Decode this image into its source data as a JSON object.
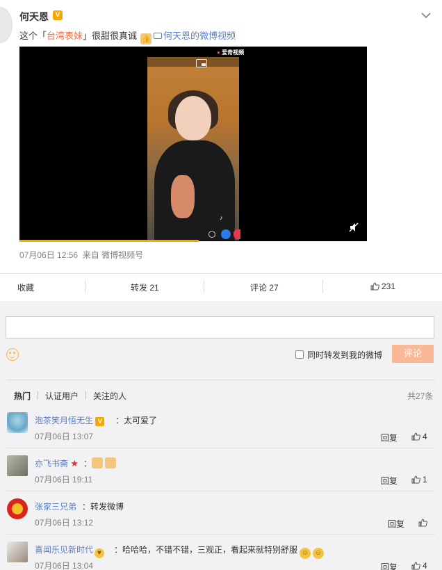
{
  "post": {
    "author": "何天恩",
    "text_prefix": "这个「",
    "tag": "台湾表妹",
    "text_mid": "」很甜很真诚",
    "video_link": "何天恩的微博视频",
    "timestamp": "07月06日 12:56",
    "source": "来自 微博视频号",
    "brand": "爱奇视频"
  },
  "actions": {
    "favorite": "收藏",
    "repost": "转发 21",
    "comment": "评论 27",
    "like": "231"
  },
  "composer": {
    "placeholder": "",
    "repost_option": "同时转发到我的微博",
    "submit": "评论"
  },
  "filters": {
    "tabs": [
      "热门",
      "认证用户",
      "关注的人"
    ],
    "total": "共27条"
  },
  "comments": [
    {
      "name": "泡茶笑月悟无生",
      "text": "：太可爱了",
      "time": "07月06日 13:07",
      "reply": "回复",
      "likes": "4"
    },
    {
      "name": "亦飞书斋",
      "text": "：",
      "time": "07月06日 19:11",
      "reply": "回复",
      "likes": "1"
    },
    {
      "name": "张家三兄弟",
      "text": "：转发微博",
      "time": "07月06日 13:12",
      "reply": "回复",
      "likes": ""
    },
    {
      "name": "喜闻乐见新时代",
      "text": "：哈哈哈，不错不错，三观正，看起来就特别舒服",
      "time": "07月06日 13:04",
      "reply": "回复",
      "likes": "4"
    }
  ],
  "colors": {
    "accent": "#eb7350",
    "link": "#5b7fc7",
    "submit_disabled": "#f9b996",
    "progress": "#f6a800"
  }
}
